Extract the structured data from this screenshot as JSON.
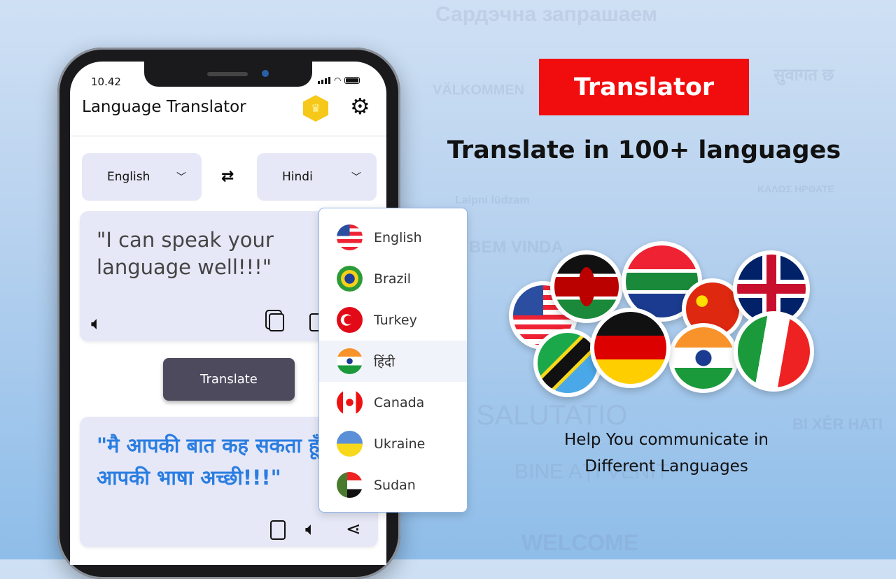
{
  "background_words": [
    "Сардэчна запрашаем",
    "VÄLKOMMEN",
    "सुवागत छ",
    "Laipni lūdzam",
    "BEM VINDA",
    "SALUTATIO",
    "BINE AȚI VENIT",
    "BI XÊR HATI",
    "WELCOME",
    "KAΛΩΣ ΗΡΘΑΤΕ"
  ],
  "phone": {
    "status_time": "10.42",
    "app_title": "Language Translator",
    "premium_icon": "crown-icon",
    "settings_icon": "gear-icon",
    "source_language": "English",
    "target_language": "Hindi",
    "swap_icon": "swap-arrows-icon",
    "source_text": "\"I can speak your language well!!!\"",
    "translate_button": "Translate",
    "translated_text": "\"मै आपकी बात कह सकता हूँ आपकी भाषा अच्छी!!!\"",
    "dropdown_options": [
      {
        "label": "English",
        "flag": "usa"
      },
      {
        "label": "Brazil",
        "flag": "brazil"
      },
      {
        "label": "Turkey",
        "flag": "turkey"
      },
      {
        "label": "हिंदी",
        "flag": "india",
        "highlighted": true
      },
      {
        "label": "Canada",
        "flag": "canada"
      },
      {
        "label": "Ukraine",
        "flag": "ukraine"
      },
      {
        "label": "Sudan",
        "flag": "sudan"
      }
    ]
  },
  "promo": {
    "banner": "Translator",
    "headline": "Translate in 100+ languages",
    "subtitle_line1": "Help You communicate in",
    "subtitle_line2": "Different Languages",
    "banner_color": "#f10d0d",
    "accent_text_color": "#2a7de1"
  }
}
